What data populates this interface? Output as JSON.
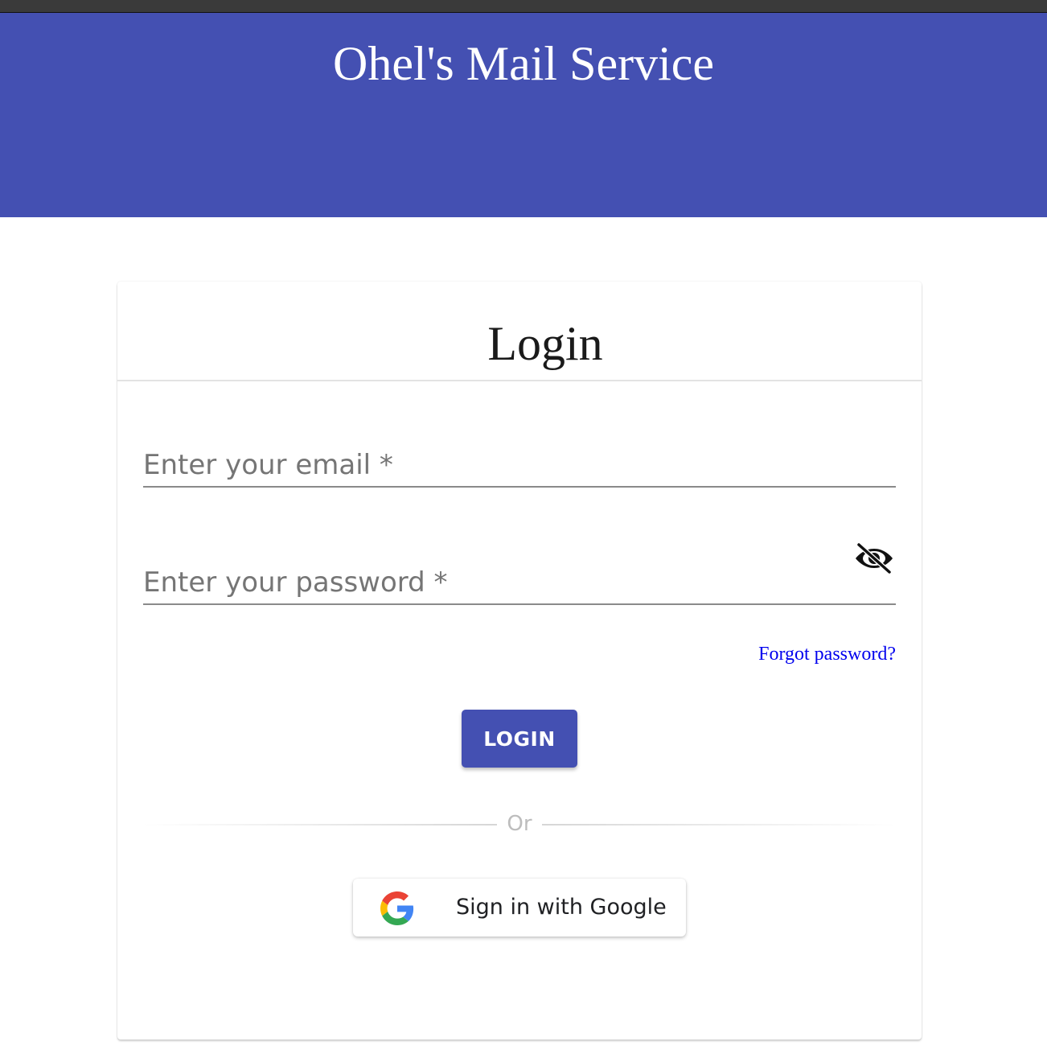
{
  "header": {
    "title": "Ohel's Mail Service",
    "background_color": "#4450b2"
  },
  "login_card": {
    "title": "Login",
    "email_field": {
      "placeholder": "Enter your email *",
      "value": ""
    },
    "password_field": {
      "placeholder": "Enter your password *",
      "value": "",
      "visibility_icon": "eye-off-icon"
    },
    "forgot_password_label": "Forgot password?",
    "login_button_label": "LOGIN",
    "divider_label": "Or",
    "google_button": {
      "label": "Sign in with Google",
      "icon": "google-g-icon"
    }
  },
  "colors": {
    "primary": "#4450b2",
    "link": "#0000ee",
    "input_text": "#757575"
  }
}
